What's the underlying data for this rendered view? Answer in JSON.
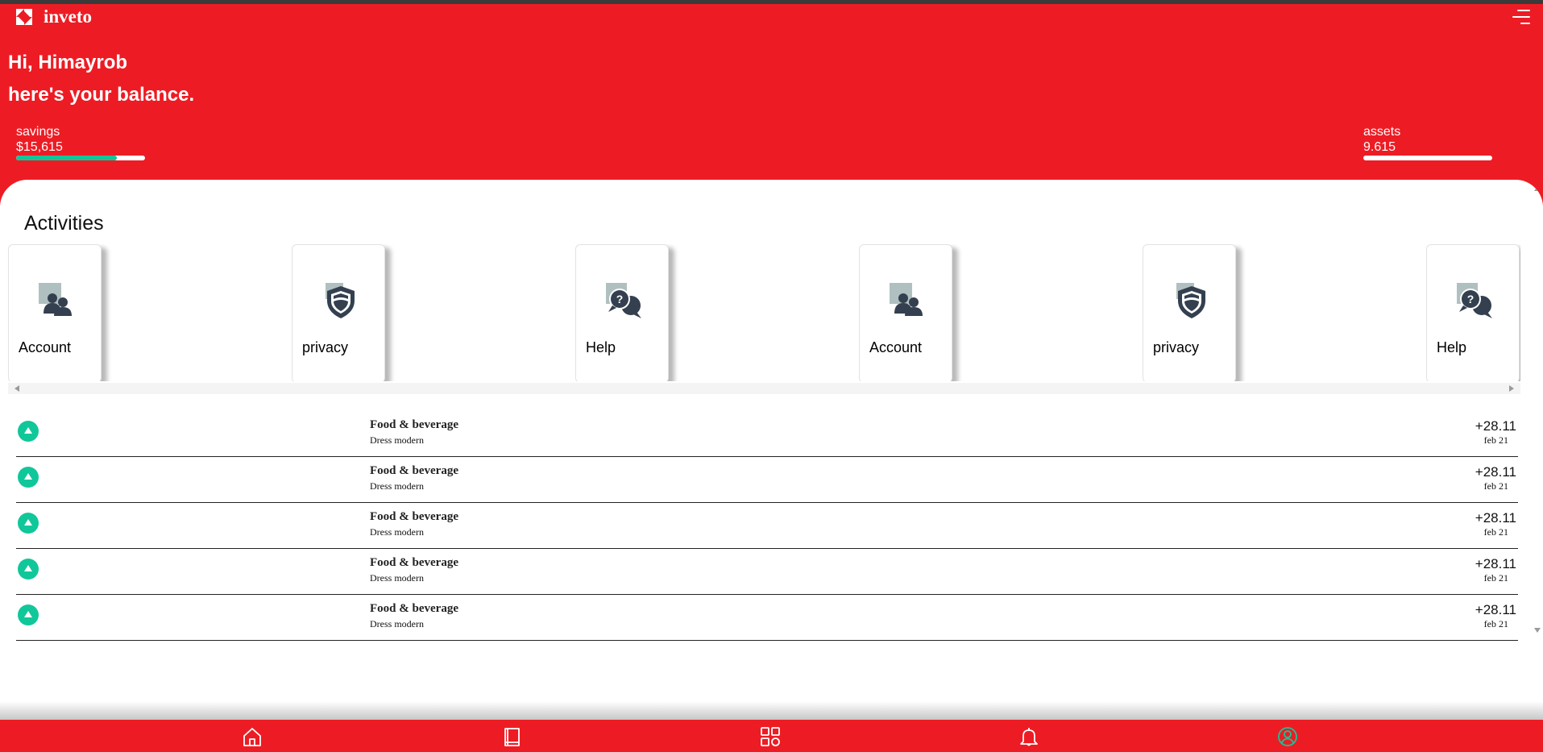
{
  "app": {
    "name": "inveto"
  },
  "greeting": {
    "line1": "Hi, Himayrob",
    "line2": "here's your balance."
  },
  "stats": {
    "savings": {
      "label": "savings",
      "value": "$15,615",
      "progress": 0.78
    },
    "assets": {
      "label": "assets",
      "value": "9.615",
      "progress": 0.0
    }
  },
  "activities": {
    "title": "Activities",
    "cards": [
      {
        "label": "Account",
        "icon": "account-icon"
      },
      {
        "label": "privacy",
        "icon": "shield-icon"
      },
      {
        "label": "Help",
        "icon": "help-chat-icon"
      },
      {
        "label": "Account",
        "icon": "account-icon"
      },
      {
        "label": "privacy",
        "icon": "shield-icon"
      },
      {
        "label": "Help",
        "icon": "help-chat-icon"
      }
    ]
  },
  "transactions": [
    {
      "title": "Food & beverage",
      "subtitle": "Dress modern",
      "amount": "+28.11",
      "date": "feb 21"
    },
    {
      "title": "Food & beverage",
      "subtitle": "Dress modern",
      "amount": "+28.11",
      "date": "feb 21"
    },
    {
      "title": "Food & beverage",
      "subtitle": "Dress modern",
      "amount": "+28.11",
      "date": "feb 21"
    },
    {
      "title": "Food & beverage",
      "subtitle": "Dress modern",
      "amount": "+28.11",
      "date": "feb 21"
    },
    {
      "title": "Food & beverage",
      "subtitle": "Dress modern",
      "amount": "+28.11",
      "date": "feb 21"
    }
  ],
  "bottom_nav": [
    "home-icon",
    "book-icon",
    "grid-icon",
    "bell-icon",
    "profile-icon"
  ],
  "colors": {
    "brand": "#ed1c24",
    "accent": "#10c79a",
    "icon_dark": "#34404f"
  }
}
